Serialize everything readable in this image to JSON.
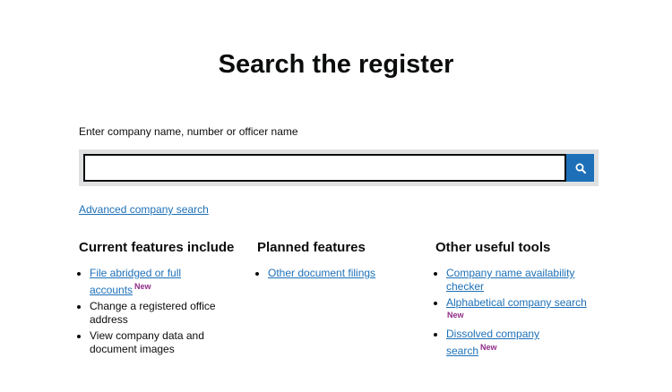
{
  "page": {
    "title": "Search the register"
  },
  "search": {
    "label": "Enter company name, number or officer name",
    "value": "",
    "placeholder": "",
    "button_icon": "search-icon"
  },
  "advanced_link": "Advanced company search",
  "columns": [
    {
      "heading": "Current features include",
      "items": [
        {
          "text": "File abridged or full accounts",
          "link": true,
          "badge": "New"
        },
        {
          "text": "Change a registered office address",
          "link": false
        },
        {
          "text": "View company data and document images",
          "link": false
        }
      ]
    },
    {
      "heading": "Planned features",
      "items": [
        {
          "text": "Other document filings",
          "link": true
        }
      ]
    },
    {
      "heading": "Other useful tools",
      "items": [
        {
          "text": "Company name availability checker",
          "link": true
        },
        {
          "text": "Alphabetical company search",
          "link": true,
          "badge": "New"
        },
        {
          "text": "Dissolved company search",
          "link": true,
          "badge": "New"
        }
      ]
    }
  ],
  "colors": {
    "link": "#1d70b8",
    "button": "#1d70b8",
    "badge": "#912b88",
    "search_bg": "#dee0e2"
  }
}
